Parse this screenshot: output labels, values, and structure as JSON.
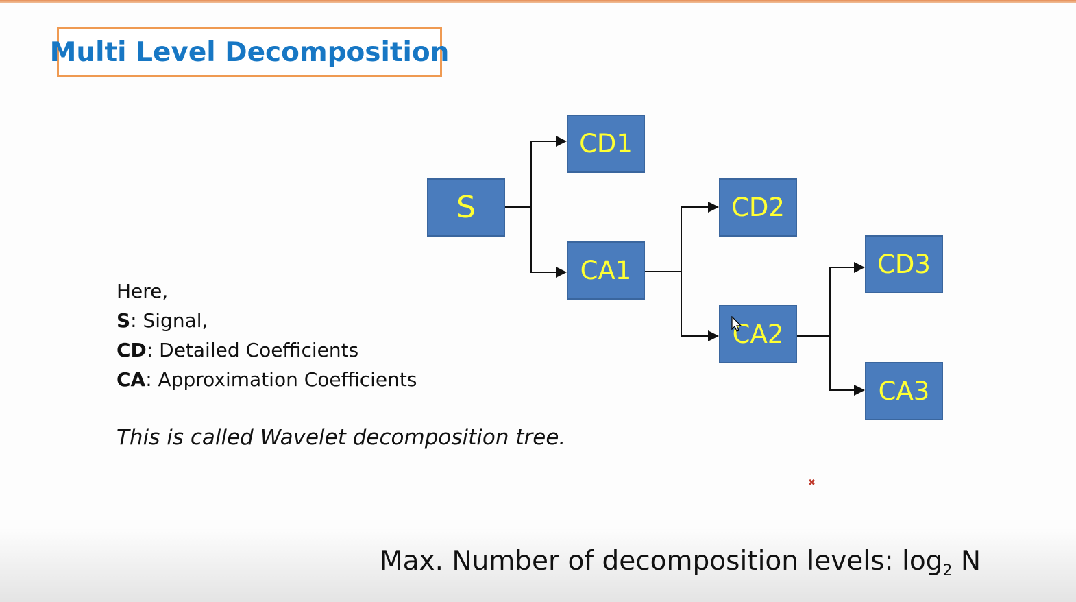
{
  "slide": {
    "title": "Multi Level Decomposition"
  },
  "tree": {
    "nodes": {
      "s": "S",
      "cd1": "CD1",
      "ca1": "CA1",
      "cd2": "CD2",
      "ca2": "CA2",
      "cd3": "CD3",
      "ca3": "CA3"
    },
    "node_colors": {
      "fill": "#4a7cbd",
      "text": "#ffff33"
    }
  },
  "legend": {
    "intro": "Here,",
    "items": [
      {
        "key": "S",
        "desc": ": Signal,"
      },
      {
        "key": "CD",
        "desc": ": Detailed Coefficients"
      },
      {
        "key": "CA",
        "desc": ": Approximation Coefficients"
      }
    ]
  },
  "caption": "This is called Wavelet decomposition tree.",
  "bottom_note": {
    "prefix": "Max. Number of decomposition levels: log",
    "subscript": "2",
    "suffix": " N"
  }
}
